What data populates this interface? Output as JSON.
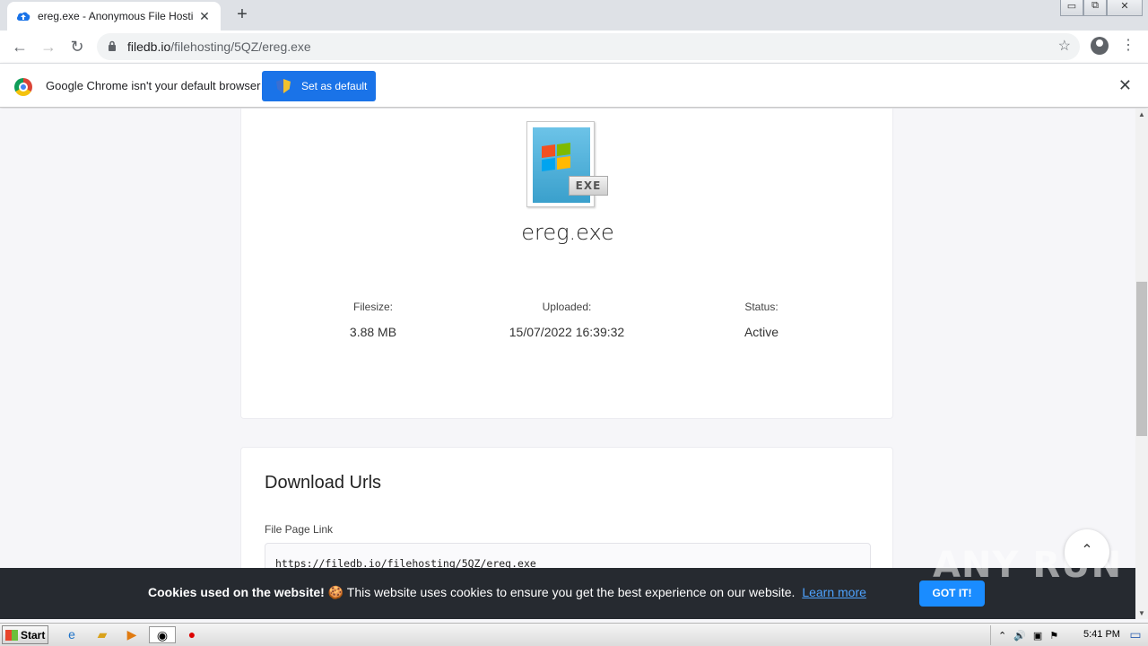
{
  "browser": {
    "tab_title": "ereg.exe - Anonymous File Hosting S",
    "tab_close": "✕",
    "new_tab": "+",
    "url_host": "filedb.io",
    "url_path": "/filehosting/5QZ/ereg.exe",
    "window_controls": [
      "▭",
      "⧉",
      "✕"
    ]
  },
  "infobar": {
    "message": "Google Chrome isn't your default browser",
    "button_label": "Set as default",
    "close": "✕"
  },
  "file": {
    "icon_tag": "EXE",
    "name": "ereg.exe",
    "filesize_label": "Filesize:",
    "filesize": "3.88 MB",
    "uploaded_label": "Uploaded:",
    "uploaded": "15/07/2022 16:39:32",
    "status_label": "Status:",
    "status": "Active"
  },
  "downloads": {
    "heading": "Download Urls",
    "page_link_label": "File Page Link",
    "page_link": "https://filedb.io/filehosting/5QZ/ereg.exe"
  },
  "cookie": {
    "bold": "Cookies used on the website!",
    "emoji": "🍪",
    "text": "This website uses cookies to ensure you get the best experience on our website.",
    "learn_more": "Learn more",
    "ok": "GOT IT!"
  },
  "watermark": "ANY RUN",
  "taskbar": {
    "start": "Start",
    "clock": "5:41 PM"
  },
  "icons": {
    "back": "←",
    "forward": "→",
    "reload": "↻",
    "lock": "🔒",
    "star": "☆",
    "kebab": "⋮",
    "to_top": "⌃"
  }
}
